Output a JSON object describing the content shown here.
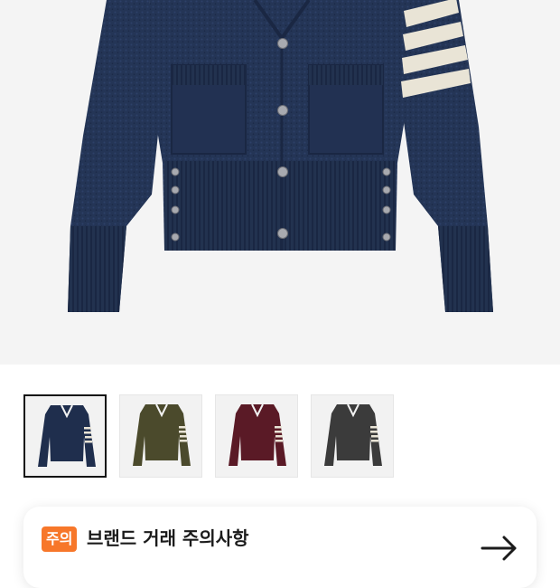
{
  "product_image": {
    "icon": "navy-cardigan-photo",
    "selected_index": 0
  },
  "thumbnails": [
    {
      "name": "navy-cardigan",
      "color": "#1f2e4d"
    },
    {
      "name": "olive-cardigan",
      "color": "#4b4a2c"
    },
    {
      "name": "burgundy-cardigan",
      "color": "#5a1a26"
    },
    {
      "name": "charcoal-cardigan",
      "color": "#3b3b3b"
    }
  ],
  "notice": {
    "badge": "주의",
    "title": "브랜드 거래 주의사항",
    "subtitle": "",
    "accent_color": "#f7772a",
    "arrow_icon": "arrow-right-icon"
  }
}
